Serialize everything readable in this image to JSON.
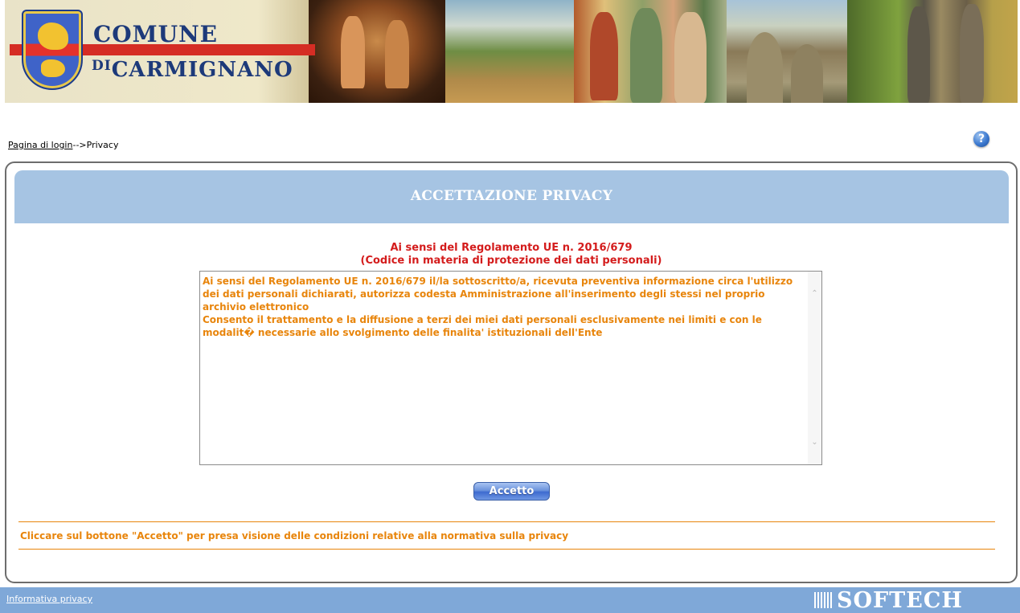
{
  "header": {
    "comune_label": "COMUNE",
    "carmignano_label": "DICARMIGNANO",
    "carmignano_prefix": "DI",
    "carmignano_name": "CARMIGNANO"
  },
  "breadcrumb": {
    "login_link": "Pagina di login",
    "separator": "-->",
    "current": "Privacy"
  },
  "help_icon": {
    "glyph": "?",
    "icon": "help-icon"
  },
  "title_bar": {
    "title": "ACCETTAZIONE PRIVACY"
  },
  "regulation": {
    "line1": "Ai sensi del Regolamento UE n. 2016/679",
    "line2": "(Codice in materia di protezione dei dati personali)"
  },
  "privacy_text": {
    "paragraph1": "Ai sensi del Regolamento UE n. 2016/679 il/la sottoscritto/a, ricevuta preventiva informazione circa l'utilizzo dei dati personali dichiarati, autorizza codesta Amministrazione all'inserimento degli stessi nel proprio archivio elettronico",
    "paragraph2": "Consento il trattamento e la diffusione a terzi dei miei dati personali esclusivamente nei limiti e con le modalit� necessarie allo svolgimento delle finalita' istituzionali dell'Ente"
  },
  "buttons": {
    "accept_label": "Accetto"
  },
  "notice": {
    "text": "Cliccare sul bottone \"Accetto\" per presa visione delle condizioni relative alla normativa sulla privacy"
  },
  "footer": {
    "privacy_link": "Informativa privacy",
    "logo_text": "SOFTECH"
  },
  "colors": {
    "title_bar": "#a6c4e3",
    "heading_red": "#d41c1c",
    "text_orange": "#e8850c",
    "footer_blue": "#7fa8d8",
    "button_blue": "#3d6ad0"
  }
}
